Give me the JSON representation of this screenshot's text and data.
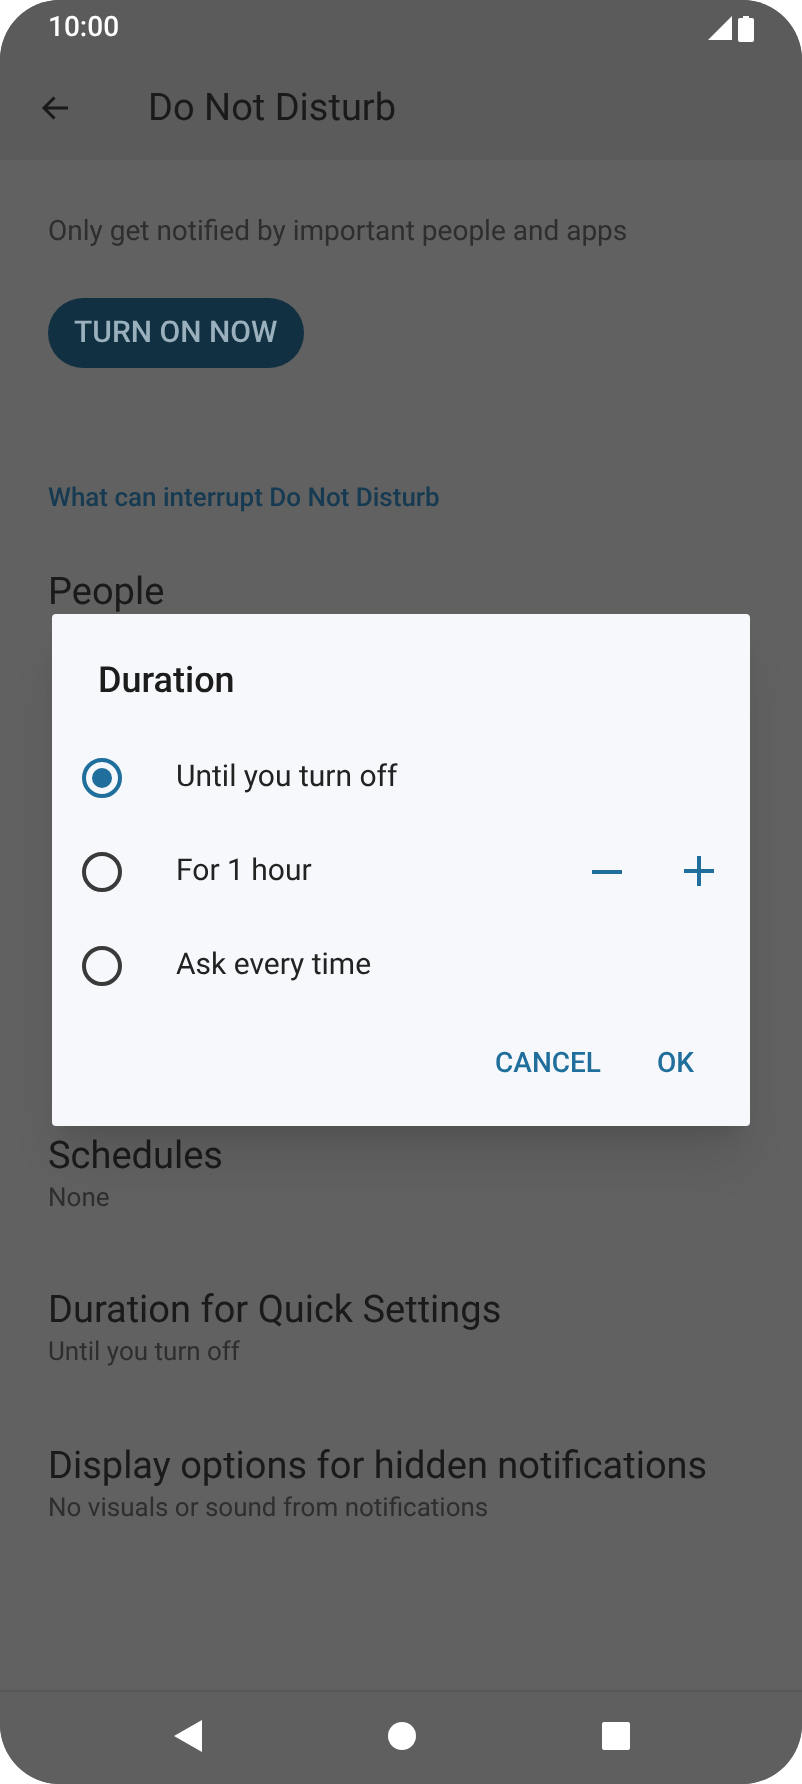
{
  "status_bar": {
    "time": "10:00"
  },
  "header": {
    "title": "Do Not Disturb"
  },
  "description": "Only get notified by important people and apps",
  "turn_on_button": "TURN ON NOW",
  "section_header": "What can interrupt Do Not Disturb",
  "settings_top": [
    {
      "title": "People"
    }
  ],
  "settings_bottom": [
    {
      "title": "Schedules",
      "subtitle": "None"
    },
    {
      "title": "Duration for Quick Settings",
      "subtitle": "Until you turn off"
    },
    {
      "title": "Display options for hidden notifications",
      "subtitle": "No visuals or sound from notifications"
    }
  ],
  "dialog": {
    "title": "Duration",
    "options": [
      {
        "label": "Until you turn off",
        "selected": true,
        "kind": "plain"
      },
      {
        "label": "For 1 hour",
        "selected": false,
        "kind": "stepper"
      },
      {
        "label": "Ask every time",
        "selected": false,
        "kind": "plain"
      }
    ],
    "buttons": [
      "CANCEL",
      "OK"
    ]
  }
}
